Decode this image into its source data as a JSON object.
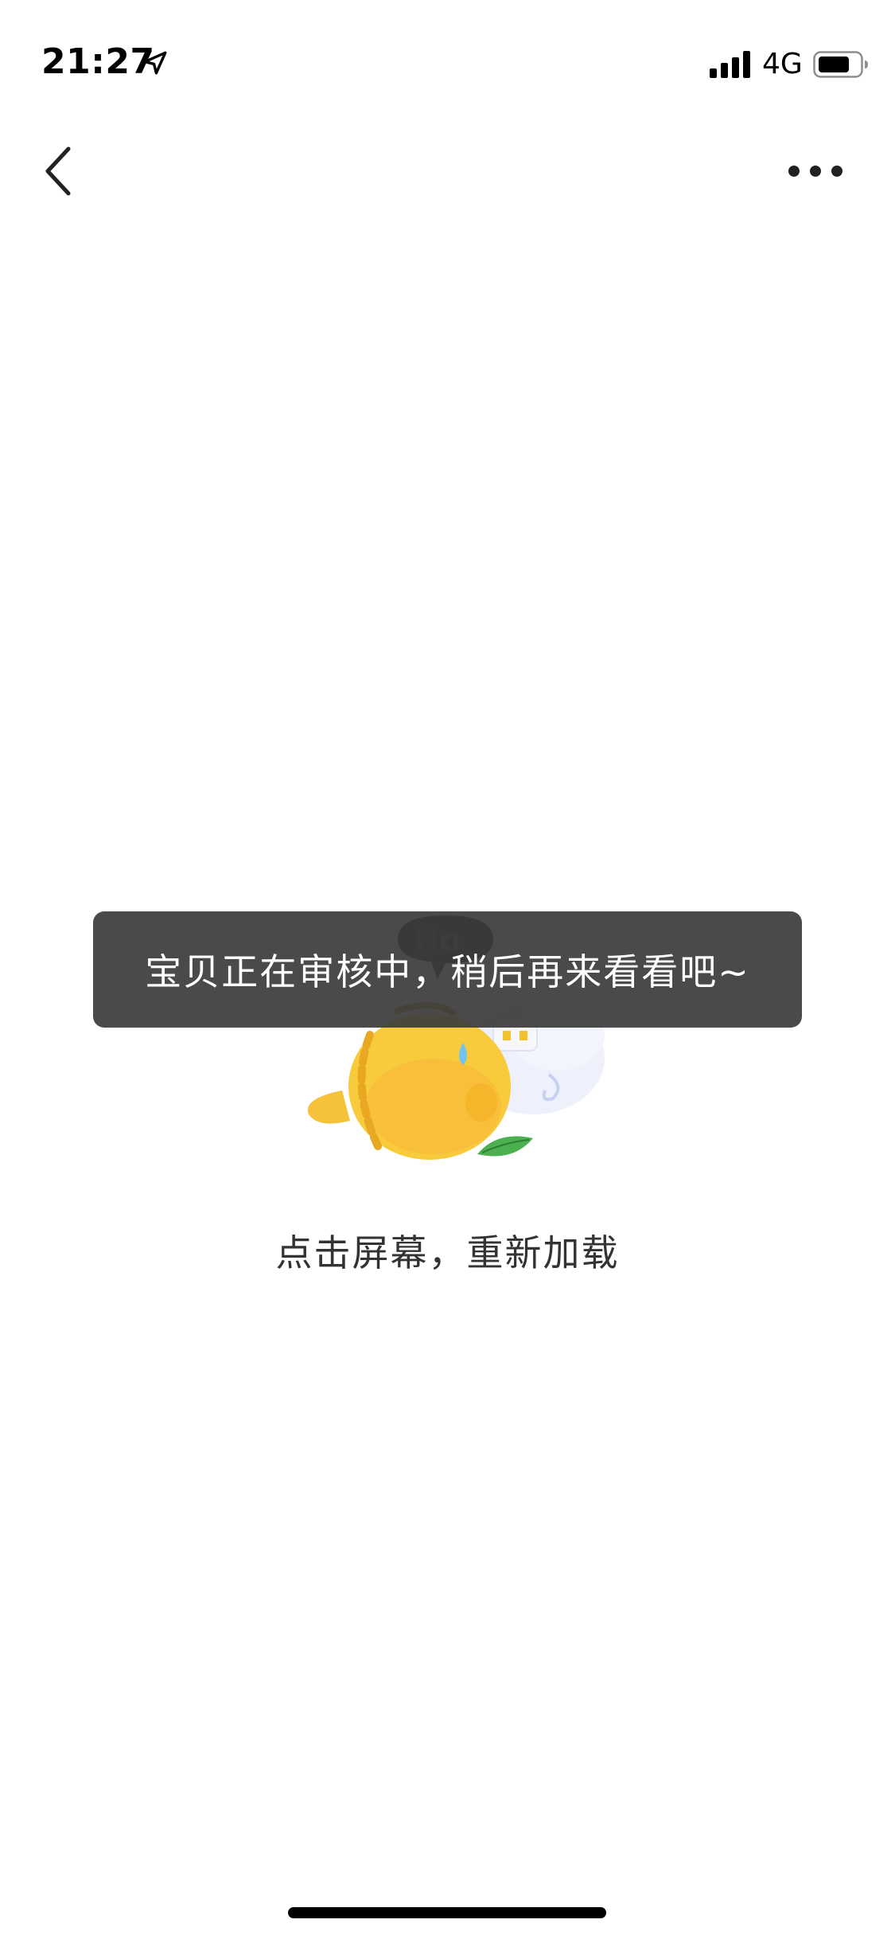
{
  "status_bar": {
    "time": "21:27",
    "network": "4G",
    "icons": [
      "location-arrow-icon",
      "signal-bars-icon",
      "battery-icon"
    ]
  },
  "nav": {
    "back_icon": "chevron-left-icon",
    "more_icon": "more-dots-icon"
  },
  "content": {
    "mascot": "fish-mascot-no-illustration",
    "reload_text": "点击屏幕，重新加载"
  },
  "toast": {
    "message": "宝贝正在审核中，稍后再来看看吧~"
  },
  "colors": {
    "background": "#ffffff",
    "toast_bg": "#3c3c3c",
    "text": "#333333",
    "mascot_yellow": "#f7c531"
  }
}
